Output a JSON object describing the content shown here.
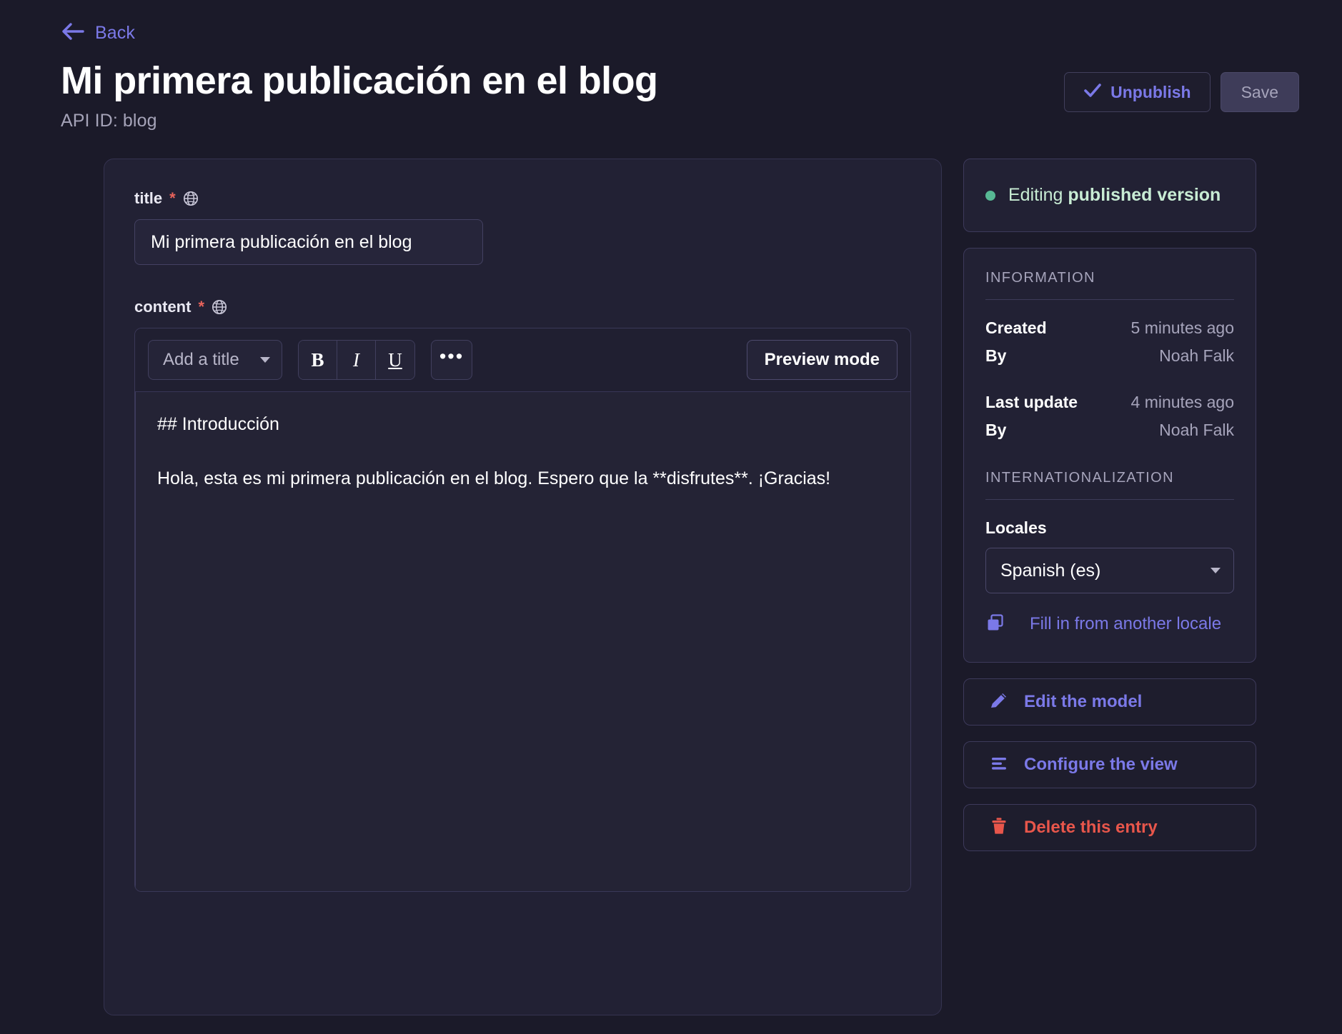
{
  "header": {
    "back_label": "Back",
    "back_icon": "arrow-left-icon",
    "title": "Mi primera publicación en el blog",
    "api_id": "API ID: blog",
    "unpublish_label": "Unpublish",
    "unpublish_icon": "check-icon",
    "save_label": "Save"
  },
  "form": {
    "title_field": {
      "label": "title",
      "required_mark": "*",
      "icon": "globe-icon",
      "value": "Mi primera publicación en el blog"
    },
    "content_field": {
      "label": "content",
      "required_mark": "*",
      "icon": "globe-icon",
      "toolbar": {
        "title_select": "Add a title",
        "bold": "B",
        "italic": "I",
        "underline": "U",
        "more": "•••",
        "preview_label": "Preview mode"
      },
      "body_line1": "## Introducción",
      "body_line2": "Hola, esta es mi primera publicación en el blog. Espero que la **disfrutes**. ¡Gracias!"
    }
  },
  "sidebar": {
    "status": {
      "prefix": "Editing ",
      "emphasis": "published version",
      "dot_color": "#57b894",
      "text_color": "#c8ecd4"
    },
    "information": {
      "section_title": "INFORMATION",
      "rows": [
        {
          "key": "Created",
          "value": "5 minutes ago"
        },
        {
          "key": "By",
          "value": "Noah Falk"
        },
        {
          "key": "Last update",
          "value": "4 minutes ago"
        },
        {
          "key": "By",
          "value": "Noah Falk"
        }
      ]
    },
    "internationalization": {
      "section_title": "INTERNATIONALIZATION",
      "locales_label": "Locales",
      "locale_value": "Spanish (es)",
      "fill_link_label": "Fill in from another locale",
      "fill_link_icon": "duplicate-icon"
    },
    "actions": [
      {
        "label": "Edit the model",
        "icon": "pencil-icon",
        "color": "#7b79e8"
      },
      {
        "label": "Configure the view",
        "icon": "list-settings-icon",
        "color": "#7b79e8"
      },
      {
        "label": "Delete this entry",
        "icon": "trash-icon",
        "color": "#e8564b"
      }
    ]
  },
  "colors": {
    "background": "#1b1a29",
    "card": "#222134",
    "accent": "#7b79e8",
    "danger": "#e8564b",
    "success": "#57b894",
    "required": "#e8635b"
  }
}
